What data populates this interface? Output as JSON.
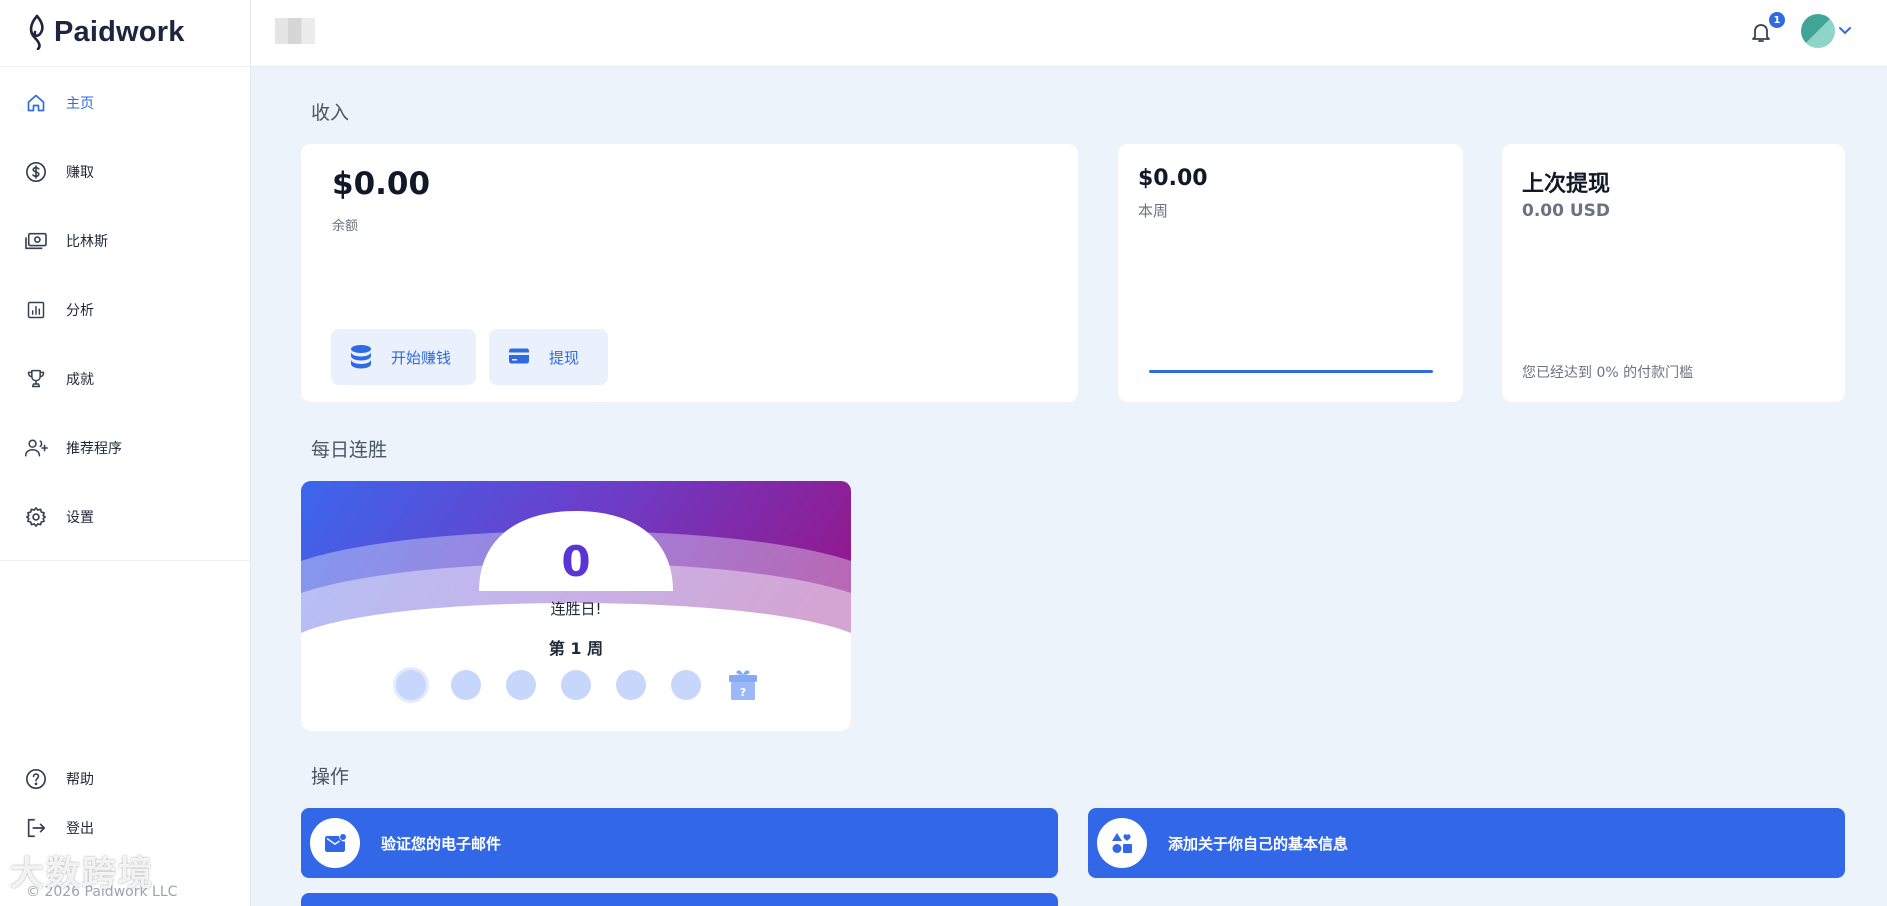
{
  "brand": {
    "name": "Paidwork"
  },
  "nav": {
    "items": [
      {
        "label": "主页",
        "icon": "home-icon",
        "active": true
      },
      {
        "label": "赚取",
        "icon": "dollar-icon",
        "active": false
      },
      {
        "label": "比林斯",
        "icon": "banknote-icon",
        "active": false
      },
      {
        "label": "分析",
        "icon": "chart-icon",
        "active": false
      },
      {
        "label": "成就",
        "icon": "trophy-icon",
        "active": false
      },
      {
        "label": "推荐程序",
        "icon": "add-user-icon",
        "active": false
      },
      {
        "label": "设置",
        "icon": "gear-icon",
        "active": false
      }
    ],
    "bottom": [
      {
        "label": "帮助",
        "icon": "help-icon"
      },
      {
        "label": "登出",
        "icon": "logout-icon"
      }
    ],
    "copyright": "© 2026 Paidwork LLC",
    "watermark": "大数跨境"
  },
  "header": {
    "notification_count": "1"
  },
  "income": {
    "title": "收入",
    "balance": {
      "amount": "$0.00",
      "label": "余额"
    },
    "buttons": {
      "earn": "开始赚钱",
      "withdraw": "提现"
    },
    "week": {
      "amount": "$0.00",
      "label": "本周"
    },
    "last_withdrawal": {
      "title": "上次提现",
      "amount": "0.00 USD",
      "note": "您已经达到 0% 的付款门槛"
    }
  },
  "streak": {
    "title": "每日连胜",
    "count": "0",
    "label": "连胜日!",
    "week": "第 1 周",
    "days_total": 6,
    "gift_mark": "?"
  },
  "operations": {
    "title": "操作",
    "items": [
      {
        "label": "验证您的电子邮件",
        "icon": "mail-icon"
      },
      {
        "label": "添加关于你自己的基本信息",
        "icon": "shapes-icon"
      }
    ]
  },
  "colors": {
    "accent": "#2f6ae0",
    "button_blue": "#3268e8",
    "streak_purple": "#5b34d6"
  }
}
